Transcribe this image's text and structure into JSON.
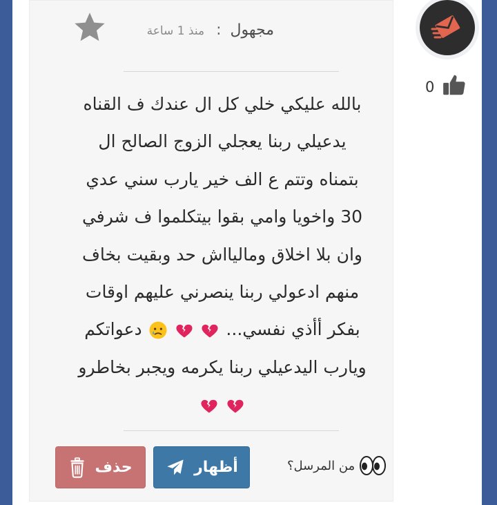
{
  "message": {
    "sender": "مجهول",
    "separator": ":",
    "time": "منذ 1 ساعة",
    "likes": "0",
    "lines": [
      "بالله عليكي خلي كل ال عندك ف القناه",
      "يدعيلي ربنا يعجلي الزوج الصالح ال",
      "بتمناه وتتم ع الف خير يارب سني عدي",
      "30 واخويا وامي بقوا بيتكلموا ف شرفي",
      "وان بلا اخلاق وماليااش حد وبقيت بخاف",
      "منهم ادعولي ربنا ينصرني عليهم اوقات",
      "بفكر أأذي نفسي...",
      "دعواتكم",
      "ويارب اليدعيلي ربنا يكرمه ويجبر بخاطرو"
    ]
  },
  "actions": {
    "ask_sender": "من المرسل؟",
    "show_label": "أظهار",
    "delete_label": "حذف"
  },
  "icons": {
    "avatar": "envelope-icon",
    "like": "thumbs-up-icon",
    "favorite": "star-icon",
    "eyes": "eyes-icon",
    "send": "paper-plane-icon",
    "trash": "trash-icon",
    "broken_heart": "broken-heart-icon",
    "sad_face": "sad-tear-face-icon"
  },
  "colors": {
    "show_button": "#3d78a7",
    "delete_button": "#c87373",
    "avatar_bg": "#2d2d2d",
    "avatar_icon": "#e2664f",
    "frame": "#3b5b99"
  }
}
